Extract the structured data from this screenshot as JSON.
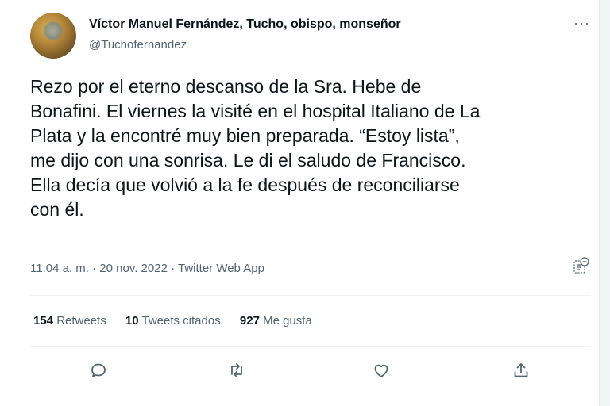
{
  "author": {
    "name": "Víctor Manuel Fernández, Tucho, obispo, monseñor",
    "handle": "@Tuchofernandez"
  },
  "more_icon": "more-horizontal-icon",
  "tweet_lines": [
    "Rezo por el eterno descanso de la Sra. Hebe de",
    "Bonafini. El viernes la visité en el hospital Italiano de La",
    "Plata y la encontré muy bien preparada. “Estoy lista”,",
    "me dijo con una sonrisa. Le di el saludo de Francisco.",
    "Ella decía que volvió a la fe después de reconciliarse",
    "con él."
  ],
  "meta": {
    "time": "11:04 a. m.",
    "separator": " · ",
    "date": "20 nov. 2022",
    "app": "Twitter Web App"
  },
  "stats": {
    "retweets_count": "154",
    "retweets_label": " Retweets",
    "quotes_count": "10",
    "quotes_label": " Tweets citados",
    "likes_count": "927",
    "likes_label": " Me gusta"
  },
  "colors": {
    "text": "#0f1419",
    "secondary": "#536471",
    "divider": "#eff3f4"
  },
  "action_icons": [
    "reply-icon",
    "retweet-icon",
    "like-icon",
    "share-icon"
  ]
}
